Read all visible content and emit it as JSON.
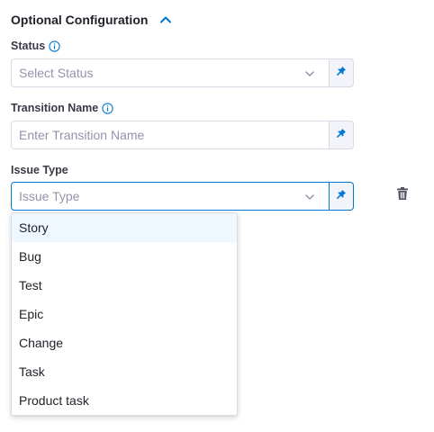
{
  "section": {
    "title": "Optional Configuration"
  },
  "status": {
    "label": "Status",
    "placeholder": "Select Status"
  },
  "transition_name": {
    "label": "Transition Name",
    "placeholder": "Enter Transition Name"
  },
  "issue_type": {
    "label": "Issue Type",
    "placeholder": "Issue Type",
    "options": [
      "Story",
      "Bug",
      "Test",
      "Epic",
      "Change",
      "Task",
      "Product task"
    ]
  },
  "icons": {
    "collapse": "chevron-up-icon",
    "info": "info-icon",
    "dropdown": "chevron-down-icon",
    "pin": "pin-icon",
    "delete": "trash-icon"
  },
  "colors": {
    "accent": "#0278d5",
    "highlight": "#f0f8ff",
    "border": "#d9dae5",
    "placeholder": "#9293ab"
  }
}
